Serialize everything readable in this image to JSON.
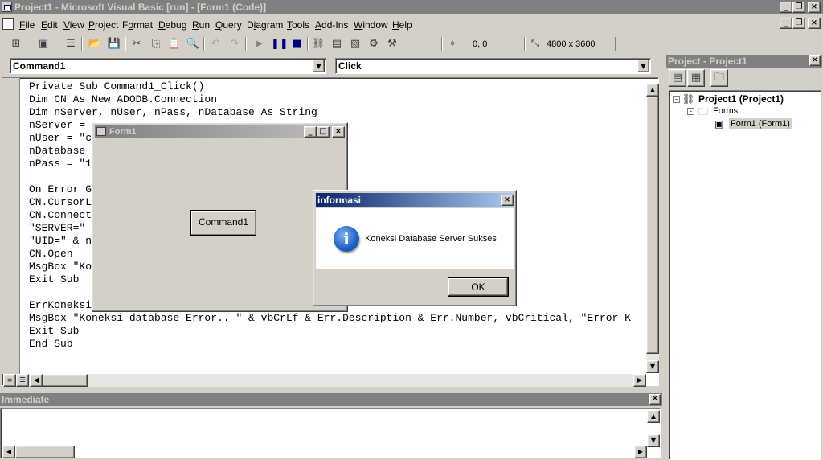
{
  "window": {
    "title": "Project1 - Microsoft Visual Basic [run] - [Form1 (Code)]"
  },
  "menu": [
    "File",
    "Edit",
    "View",
    "Project",
    "Format",
    "Debug",
    "Run",
    "Query",
    "Diagram",
    "Tools",
    "Add-Ins",
    "Window",
    "Help"
  ],
  "menu_underline": [
    "F",
    "E",
    "V",
    "P",
    "o",
    "D",
    "R",
    "Q",
    "i",
    "T",
    "A",
    "W",
    "H"
  ],
  "toolbar": {
    "position": "0, 0",
    "size": "4800 x 3600"
  },
  "code_window": {
    "object_combo": "Command1",
    "procedure_combo": "Click",
    "lines": [
      "Private Sub Command1_Click()",
      "Dim CN As New ADODB.Connection",
      "Dim nServer, nUser, nPass, nDatabase As String",
      "nServer = ",
      "nUser = \"c",
      "nDatabase ",
      "nPass = \"1",
      "",
      "On Error G",
      "CN.CursorL",
      "CN.Connect",
      "\"SERVER=\" ",
      "\"UID=\" & n",
      "CN.Open",
      "MsgBox \"Ko",
      "Exit Sub",
      "",
      "ErrKoneksi",
      "MsgBox \"Koneksi database Error.. \" & vbCrLf & Err.Description & Err.Number, vbCritical, \"Error K",
      "Exit Sub",
      "End Sub"
    ]
  },
  "form1": {
    "title": "Form1",
    "button_label": "Command1"
  },
  "msgbox": {
    "title": "informasi",
    "message": "Koneksi Database Server Sukses",
    "ok_label": "OK",
    "icon": "information-icon"
  },
  "project_explorer": {
    "title": "Project - Project1",
    "root": "Project1 (Project1)",
    "folder": "Forms",
    "item": "Form1 (Form1)"
  },
  "immediate": {
    "title": "Immediate"
  }
}
